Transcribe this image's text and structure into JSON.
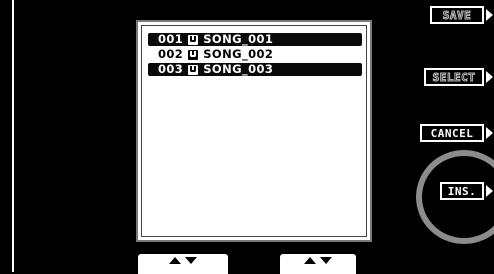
{
  "song_list": {
    "items": [
      {
        "number": "001",
        "icon": "user-memory-icon",
        "name": "SONG_001",
        "selected": true
      },
      {
        "number": "002",
        "icon": "user-memory-icon",
        "name": "SONG_002",
        "selected": false
      },
      {
        "number": "003",
        "icon": "user-memory-icon",
        "name": "SONG_003",
        "selected": true
      }
    ]
  },
  "buttons": {
    "save": "SAVE",
    "select": "SELECT",
    "cancel": "CANCEL",
    "ins": "INS."
  },
  "bottom_tabs": {
    "left_icons": [
      "triangle-up-icon",
      "triangle-down-icon"
    ],
    "right_icons": [
      "triangle-up-icon",
      "triangle-down-icon"
    ]
  },
  "colors": {
    "background": "#000000",
    "panel": "#ffffff",
    "highlight_ring": "#8c8c8c"
  }
}
